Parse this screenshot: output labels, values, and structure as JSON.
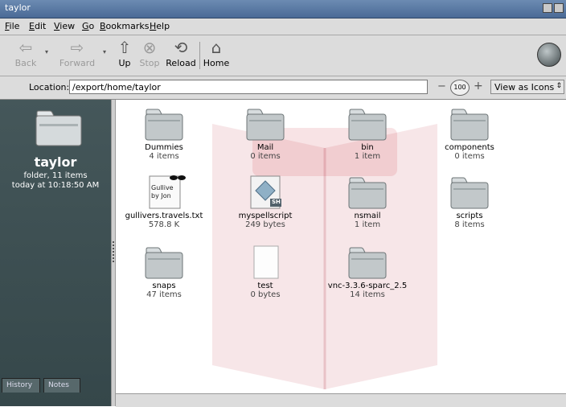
{
  "window": {
    "title": "taylor"
  },
  "menu": [
    "File",
    "Edit",
    "View",
    "Go",
    "Bookmarks",
    "Help"
  ],
  "toolbar": {
    "back": "Back",
    "forward": "Forward",
    "up": "Up",
    "stop": "Stop",
    "reload": "Reload",
    "home": "Home"
  },
  "location": {
    "label": "Location:",
    "value": "/export/home/taylor",
    "zoom": "100",
    "view_as": "View as Icons"
  },
  "sidebar": {
    "name": "taylor",
    "info": "folder, 11 items",
    "modified": "today at 10:18:50 AM",
    "tabs": [
      "History",
      "Notes"
    ]
  },
  "files": [
    {
      "name": "Dummies",
      "size": "4 items",
      "kind": "folder"
    },
    {
      "name": "Mail",
      "size": "0 items",
      "kind": "folder"
    },
    {
      "name": "bin",
      "size": "1 item",
      "kind": "folder"
    },
    {
      "name": "components",
      "size": "0 items",
      "kind": "folder"
    },
    {
      "name": "gullivers.travels.txt",
      "size": "578.8 K",
      "kind": "text",
      "preview": [
        "Gullive",
        "by Jon"
      ]
    },
    {
      "name": "myspellscript",
      "size": "249 bytes",
      "kind": "script",
      "badge": "SH"
    },
    {
      "name": "nsmail",
      "size": "1 item",
      "kind": "folder"
    },
    {
      "name": "scripts",
      "size": "8 items",
      "kind": "folder"
    },
    {
      "name": "snaps",
      "size": "47 items",
      "kind": "folder"
    },
    {
      "name": "test",
      "size": "0 bytes",
      "kind": "blank"
    },
    {
      "name": "vnc-3.3.6-sparc_2.5",
      "size": "14 items",
      "kind": "folder"
    }
  ],
  "colors": {
    "sidebar": "#3e5053",
    "folder": "#c2c8ca",
    "watermark": "#c2182b"
  }
}
